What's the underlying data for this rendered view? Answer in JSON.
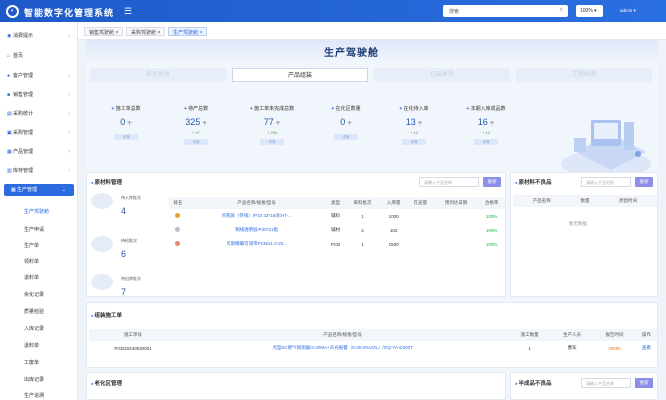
{
  "header": {
    "app_title": "智能数字化管理系统",
    "search_placeholder": "搜索",
    "zoom": "100%",
    "user": "admin"
  },
  "sidebar": {
    "items": [
      {
        "label": "消费提示"
      },
      {
        "label": "首页"
      },
      {
        "label": "客户管理"
      },
      {
        "label": "销售管理"
      },
      {
        "label": "采购统计"
      },
      {
        "label": "采购管理"
      },
      {
        "label": "产品管理"
      },
      {
        "label": "库存管理"
      },
      {
        "label": "生产管理"
      }
    ],
    "subitems": [
      "生产驾驶舱",
      "生产申请",
      "生产单",
      "领料单",
      "退料单",
      "余化记录",
      "质量检验",
      "入库记录",
      "退料单",
      "工废单",
      "出库记录",
      "生产追溯"
    ]
  },
  "tabs": [
    {
      "label": "销售驾驶舱 ×"
    },
    {
      "label": "采购驾驶舱 ×"
    },
    {
      "label": "生产驾驶舱 ×"
    }
  ],
  "page": {
    "title": "生产驾驶舱"
  },
  "steps": [
    "首页总览",
    "产品组装",
    "包装发货",
    "工程检测"
  ],
  "kpis": [
    {
      "label": "施工单总数",
      "value": "0",
      "unit": "个",
      "sub": "",
      "btn": "详情"
    },
    {
      "label": "待产总数",
      "value": "325",
      "unit": "个",
      "sub": "+ 47",
      "btn": "详情"
    },
    {
      "label": "施工单未完成总数",
      "value": "77",
      "unit": "个",
      "sub": "+ 299",
      "btn": "详情"
    },
    {
      "label": "在化区数量",
      "value": "0",
      "unit": "个",
      "sub": "",
      "btn": "详情"
    },
    {
      "label": "在化待入库",
      "value": "13",
      "unit": "个",
      "sub": "+ 13",
      "btn": "详情"
    },
    {
      "label": "本期入库成品数",
      "value": "16",
      "unit": "个",
      "sub": "+ 13",
      "btn": "详情"
    }
  ],
  "material_panel": {
    "title": "原材料管理",
    "search_placeholder": "请输入产品名称",
    "search_btn": "搜索",
    "stats": [
      {
        "label": "待入库批次",
        "value": "4"
      },
      {
        "label": "待检批次",
        "value": "6"
      },
      {
        "label": "待出库批次",
        "value": "7"
      }
    ],
    "columns": [
      "排名",
      "产品名称/规格/型号",
      "类型",
      "来料批次",
      "入库量",
      "在途量",
      "预到达日期",
      "合格率"
    ],
    "rows": [
      {
        "name": "点阵屏（带线）/P10 32*16/彩HT-...",
        "type": "辅料",
        "batch": "1",
        "qty": "1000",
        "transit": "",
        "date": "",
        "rate": "100%"
      },
      {
        "name": "铜线透明层/P20*21板",
        "type": "辅材",
        "batch": "2",
        "qty": "102",
        "transit": "",
        "date": "",
        "rate": "100%"
      },
      {
        "name": "贝斯精确可调带PCB/v1.0-20...",
        "type": "PCB",
        "batch": "1",
        "qty": "1500",
        "transit": "",
        "date": "",
        "rate": "100%"
      }
    ]
  },
  "defect_panel": {
    "title": "原材料不良品",
    "search_placeholder": "请输入产品名称",
    "search_btn": "搜索",
    "columns": [
      "产品名称",
      "数量",
      "原因时间"
    ],
    "empty": "暂无数据"
  },
  "assembly_panel": {
    "title": "组装施工单",
    "columns": [
      "施工单号",
      "产品名称/规格/型号",
      "施工数量",
      "生产人员",
      "报告时间",
      "操作"
    ],
    "rows": [
      {
        "no": "PGD20240530001",
        "name": "点型EC燃气探测器/4-20MA+声光报警（0-30.0%VOL）/GQ-YA-D300T",
        "qty": "1",
        "person": "曹军",
        "time": "2869h",
        "op": "查看"
      }
    ]
  },
  "bottom": {
    "aging": "老化区管理",
    "semi": "半成品不良品",
    "semi_placeholder": "请输入产品名称",
    "semi_btn": "搜索"
  }
}
